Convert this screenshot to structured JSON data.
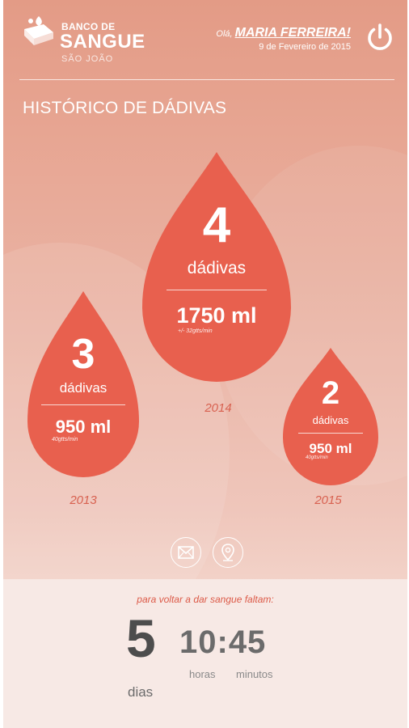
{
  "header": {
    "logo": {
      "line1": "BANCO DE",
      "line2": "SANGUE",
      "line3": "SÃO JOÃO"
    },
    "greeting": "Olá,",
    "user_name": "MARIA FERREIRA!",
    "date": "9 de Fevereiro de 2015"
  },
  "title": "HISTÓRICO DE DÁDIVAS",
  "history": [
    {
      "count": "3",
      "count_label": "dádivas",
      "volume": "950 ml",
      "rate": "40gtts/min",
      "year": "2013"
    },
    {
      "count": "4",
      "count_label": "dádivas",
      "volume": "1750 ml",
      "rate": "+/- 32gtts/min",
      "year": "2014"
    },
    {
      "count": "2",
      "count_label": "dádivas",
      "volume": "950 ml",
      "rate": "40gtts/min",
      "year": "2015"
    }
  ],
  "icons": {
    "left": "envelope-icon",
    "right": "location-pin-icon",
    "power": "power-icon"
  },
  "countdown": {
    "label": "para voltar a dar sangue faltam:",
    "days": "5",
    "days_label": "dias",
    "time": "10:45",
    "hours_label": "horas",
    "minutes_label": "minutos"
  },
  "colors": {
    "drop": "#e8604e",
    "accent": "#dc5a48",
    "panel": "#f7e9e5"
  }
}
